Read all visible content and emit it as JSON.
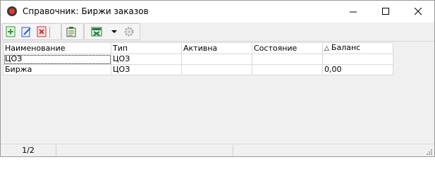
{
  "window": {
    "title": "Справочник: Биржи заказов"
  },
  "toolbar": {
    "buttons": [
      {
        "icon": "add-icon",
        "color": "#2e9a2e"
      },
      {
        "icon": "edit-icon",
        "color": "#2f5fc2"
      },
      {
        "icon": "delete-icon",
        "color": "#d32a2a"
      },
      {
        "icon": "properties-icon",
        "color": "#3b7d2a"
      },
      {
        "icon": "excel-export-icon",
        "color": "#1e7a35"
      },
      {
        "icon": "dropdown-arrow-icon"
      },
      {
        "icon": "gear-icon",
        "disabled": true
      }
    ]
  },
  "grid": {
    "columns": [
      "Наименование",
      "Тип",
      "Активна",
      "Состояние",
      "Баланс"
    ],
    "sorted_column": "Баланс",
    "sort_direction": "ascending",
    "rows": [
      [
        "ЦОЗ",
        "ЦОЗ",
        "",
        "",
        ""
      ],
      [
        "Биржа",
        "ЦОЗ",
        "",
        "",
        "0,00"
      ]
    ]
  },
  "status": {
    "pages": "1/2"
  }
}
